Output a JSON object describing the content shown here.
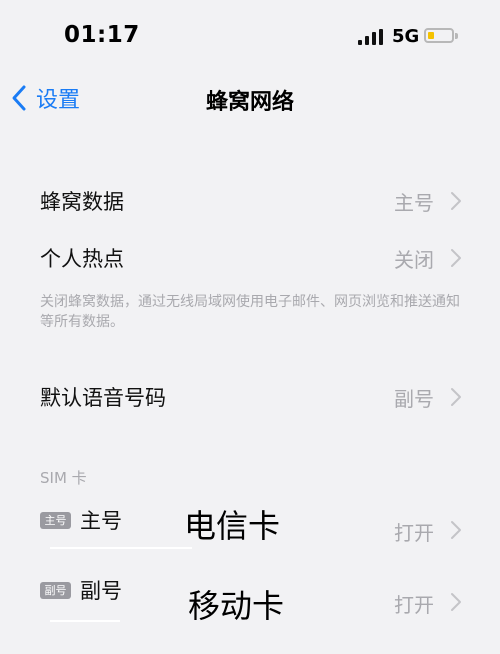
{
  "status": {
    "time": "01:17",
    "network": "5G"
  },
  "nav": {
    "back_label": "设置",
    "title": "蜂窝网络"
  },
  "rows": [
    {
      "label": "蜂窝数据",
      "value": "主号"
    },
    {
      "label": "个人热点",
      "value": "关闭"
    },
    {
      "label": "默认语音号码",
      "value": "副号"
    }
  ],
  "note": "关闭蜂窝数据，通过无线局域网使用电子邮件、网页浏览和推送通知等所有数据。",
  "sim_section": {
    "header": "SIM 卡",
    "items": [
      {
        "badge": "主号",
        "label": "主号",
        "note": "电信卡",
        "value": "打开"
      },
      {
        "badge": "副号",
        "label": "副号",
        "note": "移动卡",
        "value": "打开"
      }
    ]
  },
  "colors": {
    "accent": "#1a7cf5",
    "secondary_text": "#a9a9ae",
    "background": "#f2f2f4",
    "battery": "#f5c200"
  }
}
